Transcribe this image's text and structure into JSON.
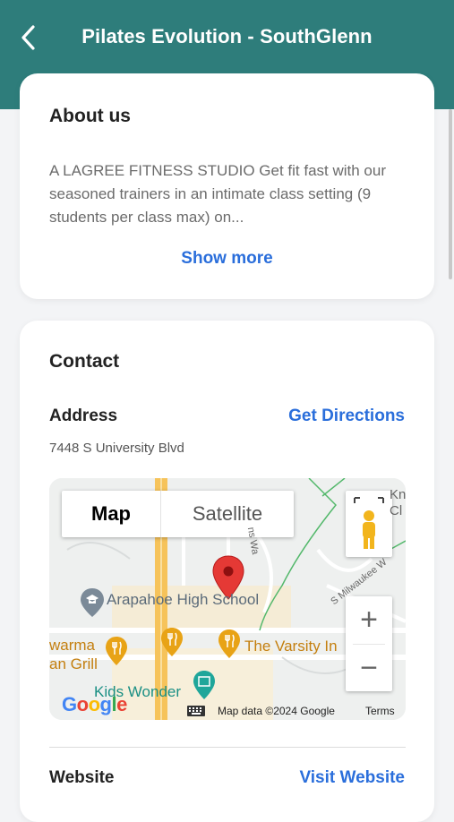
{
  "header": {
    "title": "Pilates Evolution - SouthGlenn"
  },
  "about": {
    "heading": "About us",
    "text": "A LAGREE FITNESS STUDIO   Get fit fast with our seasoned trainers in an intimate class setting (9 students per class max) on...",
    "show_more": "Show more"
  },
  "contact": {
    "heading": "Contact",
    "address_label": "Address",
    "get_directions": "Get Directions",
    "address_value": "7448 S University Blvd",
    "website_label": "Website",
    "visit_website": "Visit Website"
  },
  "map": {
    "tab_map": "Map",
    "tab_satellite": "Satellite",
    "zoom_in": "+",
    "zoom_out": "−",
    "label_school": "Arapahoe High School",
    "label_varsity": "The Varsity In",
    "label_kids": "Kids Wonder",
    "label_swarma": "warma",
    "label_grill": "an Grill",
    "label_street1": "S Milwaukee W",
    "label_street2": "ns Wa",
    "label_kn": "Kn",
    "label_cl": "Cl",
    "google": "Google",
    "map_data": "Map data ©2024 Google",
    "terms": "Terms"
  },
  "colors": {
    "header": "#2e7d7b",
    "link": "#2a6edb",
    "pin": "#e53935",
    "poi": "#e8a316",
    "poi_teal": "#1fa69a"
  }
}
